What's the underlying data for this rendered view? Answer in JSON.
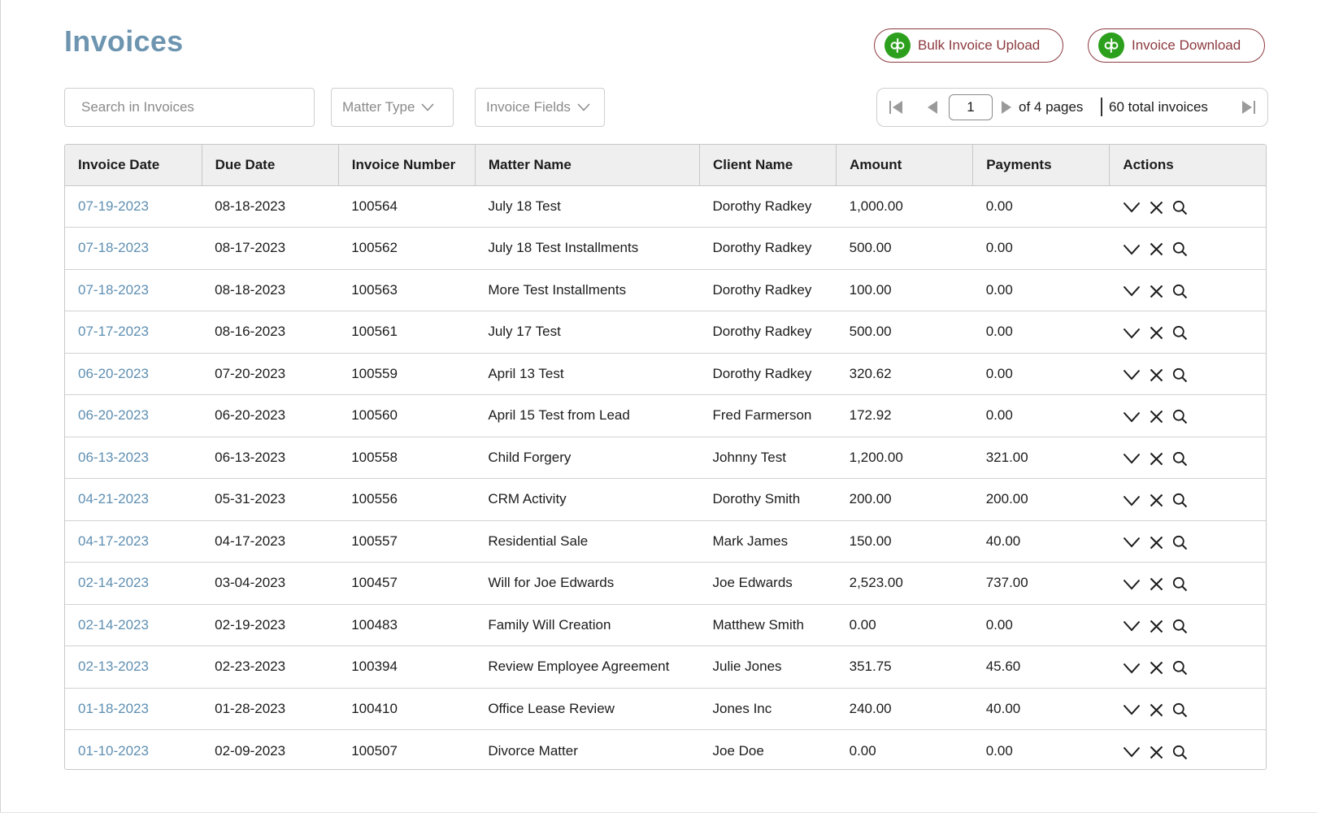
{
  "page": {
    "title": "Invoices"
  },
  "toolbar": {
    "bulk_upload_label": "Bulk Invoice Upload",
    "download_label": "Invoice Download",
    "qb_icon": "quickbooks-icon",
    "qb_color": "#2ca01c",
    "button_color": "#8c3a3f"
  },
  "filters": {
    "search_placeholder": "Search in Invoices",
    "matter_type_label": "Matter Type",
    "invoice_fields_label": "Invoice Fields"
  },
  "pagination": {
    "current_page": "1",
    "of_pages_text": "of 4 pages",
    "total_text": "60 total invoices"
  },
  "table": {
    "columns": [
      "Invoice Date",
      "Due Date",
      "Invoice Number",
      "Matter Name",
      "Client Name",
      "Amount",
      "Payments",
      "Actions"
    ],
    "rows": [
      {
        "invoice_date": "07-19-2023",
        "due_date": "08-18-2023",
        "invoice_number": "100564",
        "matter_name": "July 18 Test",
        "client_name": "Dorothy Radkey",
        "amount": "1,000.00",
        "payments": "0.00"
      },
      {
        "invoice_date": "07-18-2023",
        "due_date": "08-17-2023",
        "invoice_number": "100562",
        "matter_name": "July 18 Test Installments",
        "client_name": "Dorothy Radkey",
        "amount": "500.00",
        "payments": "0.00"
      },
      {
        "invoice_date": "07-18-2023",
        "due_date": "08-18-2023",
        "invoice_number": "100563",
        "matter_name": "More Test Installments",
        "client_name": "Dorothy Radkey",
        "amount": "100.00",
        "payments": "0.00"
      },
      {
        "invoice_date": "07-17-2023",
        "due_date": "08-16-2023",
        "invoice_number": "100561",
        "matter_name": "July 17 Test",
        "client_name": "Dorothy Radkey",
        "amount": "500.00",
        "payments": "0.00"
      },
      {
        "invoice_date": "06-20-2023",
        "due_date": "07-20-2023",
        "invoice_number": "100559",
        "matter_name": "April 13 Test",
        "client_name": "Dorothy Radkey",
        "amount": "320.62",
        "payments": "0.00"
      },
      {
        "invoice_date": "06-20-2023",
        "due_date": "06-20-2023",
        "invoice_number": "100560",
        "matter_name": "April 15 Test from Lead",
        "client_name": "Fred Farmerson",
        "amount": "172.92",
        "payments": "0.00"
      },
      {
        "invoice_date": "06-13-2023",
        "due_date": "06-13-2023",
        "invoice_number": "100558",
        "matter_name": "Child Forgery",
        "client_name": "Johnny Test",
        "amount": "1,200.00",
        "payments": "321.00"
      },
      {
        "invoice_date": "04-21-2023",
        "due_date": "05-31-2023",
        "invoice_number": "100556",
        "matter_name": "CRM Activity",
        "client_name": "Dorothy Smith",
        "amount": "200.00",
        "payments": "200.00"
      },
      {
        "invoice_date": "04-17-2023",
        "due_date": "04-17-2023",
        "invoice_number": "100557",
        "matter_name": "Residential Sale",
        "client_name": "Mark James",
        "amount": "150.00",
        "payments": "40.00"
      },
      {
        "invoice_date": "02-14-2023",
        "due_date": "03-04-2023",
        "invoice_number": "100457",
        "matter_name": "Will for Joe Edwards",
        "client_name": "Joe Edwards",
        "amount": "2,523.00",
        "payments": "737.00"
      },
      {
        "invoice_date": "02-14-2023",
        "due_date": "02-19-2023",
        "invoice_number": "100483",
        "matter_name": "Family Will Creation",
        "client_name": "Matthew Smith",
        "amount": "0.00",
        "payments": "0.00"
      },
      {
        "invoice_date": "02-13-2023",
        "due_date": "02-23-2023",
        "invoice_number": "100394",
        "matter_name": "Review Employee Agreement",
        "client_name": "Julie Jones",
        "amount": "351.75",
        "payments": "45.60"
      },
      {
        "invoice_date": "01-18-2023",
        "due_date": "01-28-2023",
        "invoice_number": "100410",
        "matter_name": "Office Lease Review",
        "client_name": "Jones Inc",
        "amount": "240.00",
        "payments": "40.00"
      },
      {
        "invoice_date": "01-10-2023",
        "due_date": "02-09-2023",
        "invoice_number": "100507",
        "matter_name": "Divorce Matter",
        "client_name": "Joe Doe",
        "amount": "0.00",
        "payments": "0.00"
      }
    ],
    "row_actions": [
      "chevron-down-icon",
      "close-icon",
      "search-icon"
    ],
    "link_color": "#5f8fb2"
  }
}
